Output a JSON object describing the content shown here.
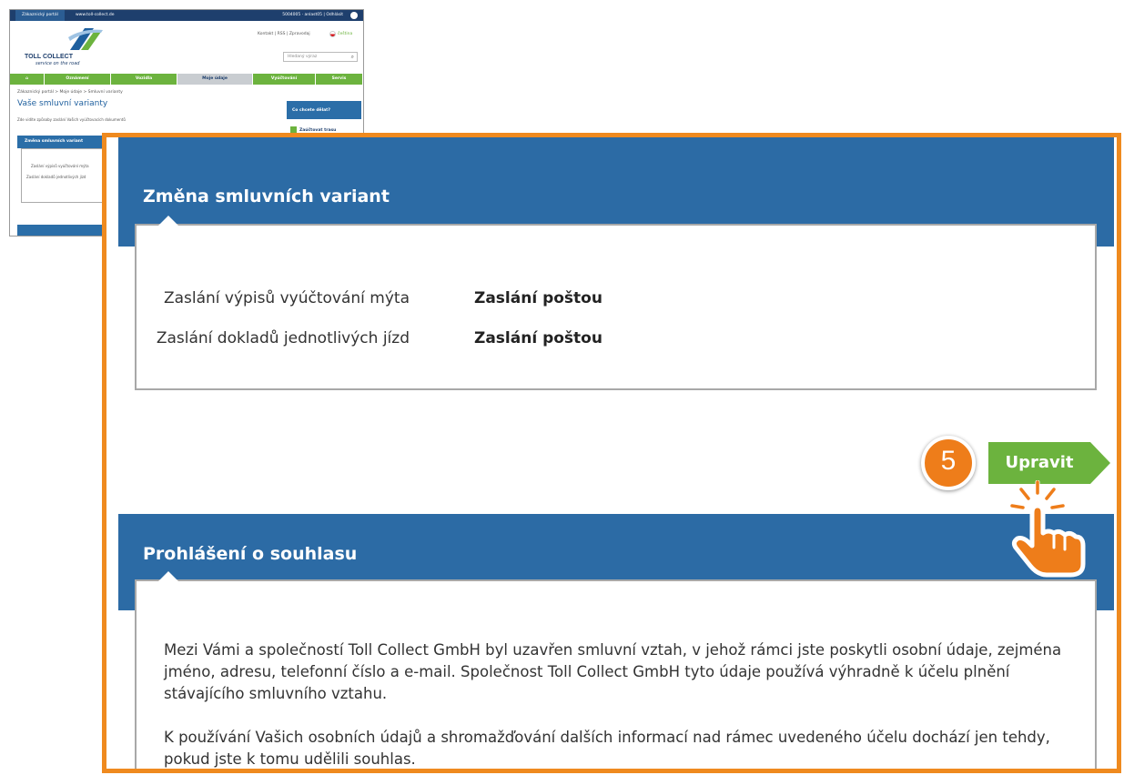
{
  "thumbnail": {
    "topbar": {
      "portal_tab": "Zákaznický portál",
      "site_link": "www.toll-collect.de",
      "user": "5004005 · anlast05 | Odhlásit"
    },
    "logo": {
      "name": "TOLL COLLECT",
      "tagline": "service on the road"
    },
    "meta_links": "Kontakt | RSS | Zpravodaj",
    "language": "čeština",
    "search_placeholder": "Hledaný výraz",
    "nav": [
      "Oznámení",
      "Vozidla",
      "Moje údaje",
      "Vyúčtování",
      "Servis"
    ],
    "breadcrumb": "Zákaznický portál > Moje údaje > Smluvní varianty",
    "page_title": "Vaše smluvní varianty",
    "subtitle": "Zde vidíte způsoby zaslání Vašich vyúčtovacích dokumentů",
    "box_heading": "Změna smluvních variant",
    "rows": [
      "Zaslání výpisů vyúčtování mýta",
      "Zaslání dokladů jednotlivých jízd"
    ],
    "sidebar": {
      "heading": "Co chcete dělat?",
      "item": "Zaúčtovat trasu"
    }
  },
  "contract_panel": {
    "heading": "Změna smluvních variant",
    "rows": [
      {
        "label": "Zaslání výpisů vyúčtování mýta",
        "value": "Zaslání poštou"
      },
      {
        "label": "Zaslání dokladů jednotlivých jízd",
        "value": "Zaslání poštou"
      }
    ]
  },
  "edit_button": {
    "label": "Upravit"
  },
  "step_badge": "5",
  "consent_panel": {
    "heading": "Prohlášení o souhlasu",
    "paragraphs": [
      "Mezi Vámi a společností Toll Collect GmbH byl uzavřen smluvní vztah, v jehož rámci jste poskytli osobní údaje, zejména jméno, adresu, telefonní číslo a e-mail. Společnost Toll Collect GmbH tyto údaje používá výhradně k účelu plnění stávajícího smluvního vztahu.",
      "K používání Vašich osobních údajů a shromažďování dalších informací nad rámec uvedeného účelu dochází jen tehdy, pokud jste k tomu udělili souhlas."
    ]
  },
  "colors": {
    "header_blue": "#2c6ba5",
    "button_green": "#6cb33e",
    "highlight_orange": "#ef8a1f",
    "badge_orange": "#ee7d1a"
  },
  "icons": [
    "user-icon",
    "search-icon",
    "home-icon",
    "pointing-hand-icon"
  ]
}
